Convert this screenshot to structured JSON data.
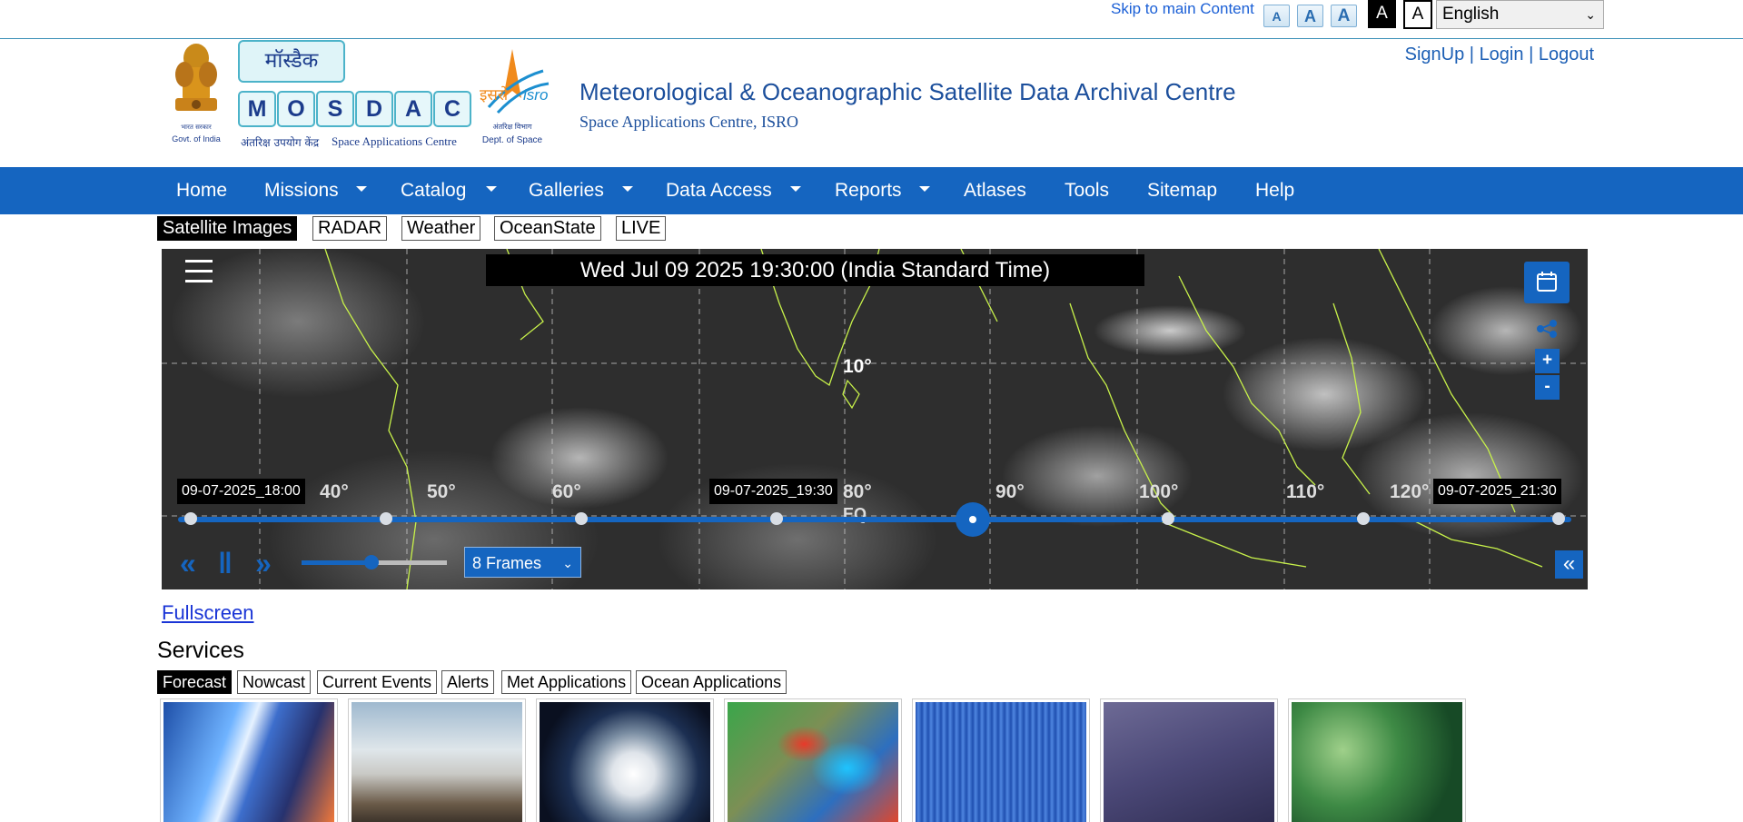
{
  "topbar": {
    "skip_link": "Skip to main Content",
    "font_small": "A",
    "font_normal": "A",
    "font_large": "A",
    "contrast_dark": "A",
    "contrast_light": "A",
    "language": "English"
  },
  "header": {
    "emblem_caption": "Govt. of India",
    "logo_top": "मॉस्डैक",
    "logo_letters": [
      "M",
      "O",
      "S",
      "D",
      "A",
      "C"
    ],
    "logo_caption_hindi": "अंतरिक्ष उपयोग केंद्र",
    "logo_caption_en": "Space Applications Centre",
    "isro_caption": "Dept. of Space",
    "title": "Meteorological & Oceanographic Satellite Data Archival Centre",
    "subtitle": "Space Applications Centre, ISRO",
    "auth": {
      "signup": "SignUp",
      "sep": "|",
      "login": "Login",
      "logout": "Logout"
    }
  },
  "nav": {
    "items": [
      {
        "label": "Home"
      },
      {
        "label": "Missions"
      },
      {
        "label": "Catalog"
      },
      {
        "label": "Galleries"
      },
      {
        "label": "Data Access"
      },
      {
        "label": "Reports"
      },
      {
        "label": "Atlases"
      },
      {
        "label": "Tools"
      },
      {
        "label": "Sitemap"
      },
      {
        "label": "Help"
      }
    ]
  },
  "image_tabs": [
    {
      "label": "Satellite Images",
      "active": true
    },
    {
      "label": "RADAR"
    },
    {
      "label": "Weather"
    },
    {
      "label": "OceanState"
    },
    {
      "label": "LIVE"
    }
  ],
  "map": {
    "datetime": "Wed Jul 09 2025 19:30:00 (India Standard Time)",
    "lat_label": "10°",
    "lon_labels": [
      "40°",
      "50°",
      "60°",
      "80°",
      "90°",
      "100°",
      "110°",
      "120°"
    ],
    "equator_label": "EQ",
    "zoom_in": "+",
    "zoom_out": "-",
    "time_start": "09-07-2025_18:00",
    "time_current": "09-07-2025_19:30",
    "time_end": "09-07-2025_21:30",
    "frames_total": 8,
    "frames_current": 4,
    "speed_level": 0.48,
    "frames_select": "8 Frames",
    "prev_label": "«",
    "pause_label": "‖",
    "next_label": "»",
    "collapse_label": "«"
  },
  "fullscreen_link": "Fullscreen",
  "services": {
    "title": "Services",
    "tabs": [
      {
        "label": "Forecast",
        "active": true
      },
      {
        "label": "Nowcast"
      },
      {
        "label": "Current Events"
      },
      {
        "label": "Alerts"
      },
      {
        "label": "Met Applications"
      },
      {
        "label": "Ocean Applications"
      }
    ]
  },
  "colors": {
    "nav_blue": "#1565c0",
    "title_blue": "#1c4f9c",
    "link_blue": "#1a35d6"
  }
}
